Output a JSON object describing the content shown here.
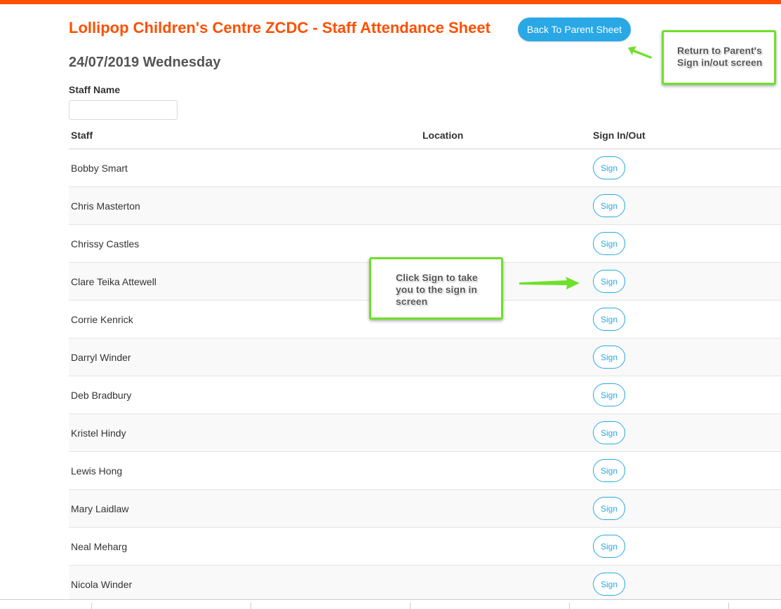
{
  "header": {
    "title": "Lollipop Children's Centre ZCDC - Staff Attendance Sheet",
    "back_button_label": "Back To Parent Sheet",
    "date": "24/07/2019 Wednesday"
  },
  "filter": {
    "label": "Staff Name",
    "value": "",
    "placeholder": ""
  },
  "table": {
    "columns": {
      "staff": "Staff",
      "location": "Location",
      "sign": "Sign In/Out"
    },
    "sign_label": "Sign",
    "rows": [
      {
        "name": "Bobby Smart",
        "location": ""
      },
      {
        "name": "Chris Masterton",
        "location": ""
      },
      {
        "name": "Chrissy Castles",
        "location": ""
      },
      {
        "name": "Clare Teika Attewell",
        "location": ""
      },
      {
        "name": "Corrie Kenrick",
        "location": ""
      },
      {
        "name": "Darryl Winder",
        "location": ""
      },
      {
        "name": "Deb Bradbury",
        "location": ""
      },
      {
        "name": "Kristel Hindy",
        "location": ""
      },
      {
        "name": "Lewis Hong",
        "location": ""
      },
      {
        "name": "Mary Laidlaw",
        "location": ""
      },
      {
        "name": "Neal Meharg",
        "location": ""
      },
      {
        "name": "Nicola Winder",
        "location": ""
      }
    ]
  },
  "annotations": {
    "return_note": "Return to Parent's Sign in/out screen",
    "sign_note": "Click Sign to take you to the sign in screen"
  },
  "colors": {
    "accent": "#ff4f00",
    "button_blue": "#29a8e5",
    "annotation_green": "#6ee02a"
  }
}
